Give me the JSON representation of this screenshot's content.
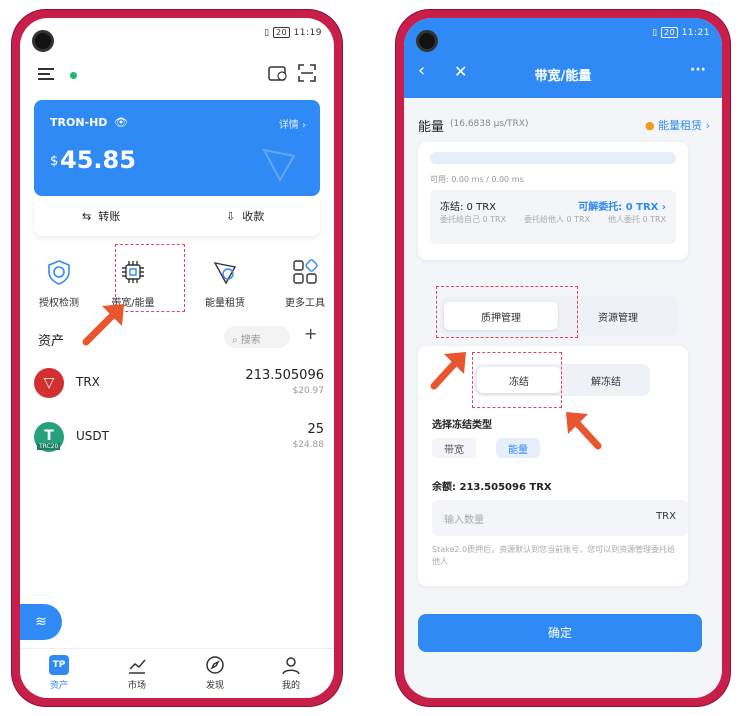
{
  "phone1": {
    "status_time": "11:19",
    "status_battery": "20",
    "wallet": {
      "name": "TRON-HD",
      "detail": "详情",
      "currency": "$",
      "balance": "45.85",
      "transfer": "转账",
      "receive": "收款"
    },
    "tools": [
      {
        "label": "授权检测",
        "icon": "shield-check-icon"
      },
      {
        "label": "带宽/能量",
        "icon": "chip-icon"
      },
      {
        "label": "能量租赁",
        "icon": "energy-rent-icon"
      },
      {
        "label": "更多工具",
        "icon": "grid-icon"
      }
    ],
    "assets_title": "资产",
    "search_placeholder": "搜索",
    "assets": [
      {
        "symbol": "TRX",
        "amount": "213.505096",
        "value": "$20.97",
        "color": "#d32f2f"
      },
      {
        "symbol": "USDT",
        "amount": "25",
        "value": "$24.88",
        "color": "#26a17b",
        "sub": "TRC20"
      }
    ],
    "nav": [
      {
        "label": "资产",
        "icon": "wallet-icon",
        "active": true
      },
      {
        "label": "市场",
        "icon": "chart-icon"
      },
      {
        "label": "发现",
        "icon": "compass-icon"
      },
      {
        "label": "我的",
        "icon": "user-icon"
      }
    ]
  },
  "phone2": {
    "status_time": "11:21",
    "status_battery": "20",
    "title": "带宽/能量",
    "energy_label": "能量",
    "energy_rate": "(16.6838 μs/TRX)",
    "energy_rent": "能量租赁",
    "available": "可用: 0.00 ms / 0.00 ms",
    "frozen": "冻结: 0 TRX",
    "delegatable": "可解委托: 0 TRX",
    "delegate_self": "委托给自己 0 TRX",
    "delegate_others": "委托给他人 0 TRX",
    "delegate_in": "他人委托 0 TRX",
    "tab_stake": "质押管理",
    "tab_resource": "资源管理",
    "freeze": "冻结",
    "unfreeze": "解冻结",
    "type_title": "选择冻结类型",
    "type_bandwidth": "带宽",
    "type_energy": "能量",
    "balance": "余额: 213.505096 TRX",
    "input_placeholder": "输入数量",
    "input_unit": "TRX",
    "note": "Stake2.0质押后，资源默认到您当前账号，您可以到资源管理委托给他人",
    "confirm": "确定"
  },
  "colors": {
    "accent": "#2f8af5",
    "brand_frame": "#c81e4a",
    "highlight": "#e0455a"
  }
}
